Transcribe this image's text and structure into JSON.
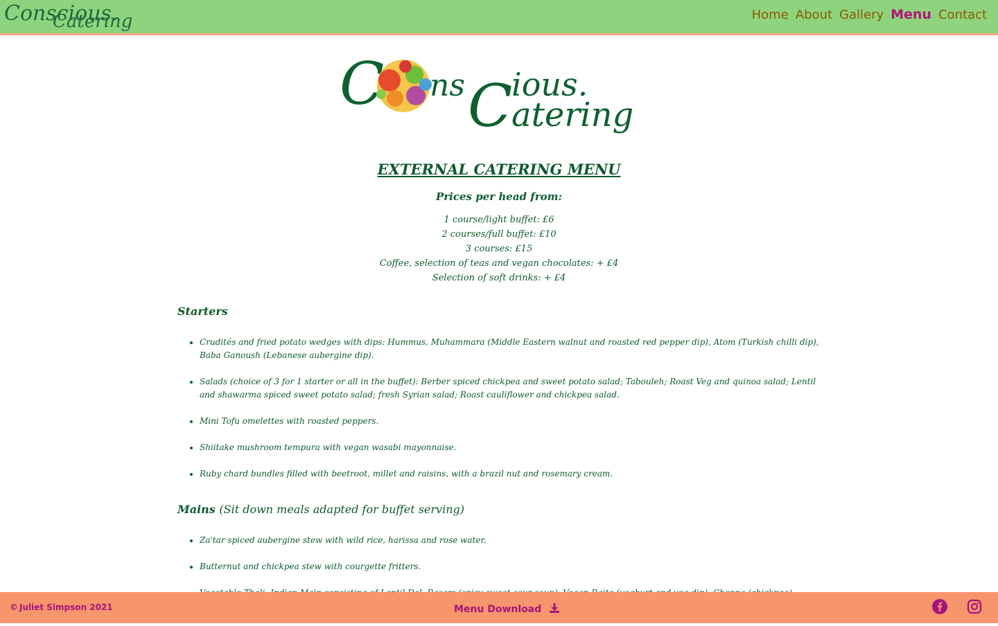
{
  "brand": {
    "logo_text_1": "Conscious.",
    "logo_text_2": "Catering"
  },
  "nav": {
    "items": [
      {
        "label": "Home"
      },
      {
        "label": "About"
      },
      {
        "label": "Gallery"
      },
      {
        "label": "Menu"
      },
      {
        "label": "Contact"
      }
    ],
    "active": "Menu"
  },
  "menu": {
    "title": "EXTERNAL CATERING MENU",
    "prices_heading": "Prices per head from:",
    "prices": [
      "1 course/light buffet: £6",
      "2 courses/full buffet: £10",
      "3 courses: £15",
      "Coffee, selection of teas and vegan chocolates: + £4",
      "Selection of soft drinks: + £4"
    ],
    "starters_heading": "Starters",
    "starters": [
      "Crudités and fried potato wedges with dips: Hummus, Muhammara (Middle Eastern walnut and roasted red pepper dip), Atom (Turkish chilli dip), Baba Ganoush (Lebanese aubergine dip).",
      "Salads (choice of 3 for 1 starter or all in the buffet): Berber spiced chickpea and sweet potato salad; Tabouleh; Roast Veg and quinoa salad; Lentil and shawarma spiced sweet potato salad; fresh Syrian salad; Roast cauliflower and chickpea salad.",
      "Mini Tofu omelettes with roasted peppers.",
      "Shiitake mushroom tempura with vegan wasabi mayonnaise.",
      "Ruby chard bundles filled with beetroot, millet and raisins, with a brazil nut and rosemary cream."
    ],
    "mains_heading": "Mains",
    "mains_sub": "(Sit down meals adapted for buffet serving)",
    "mains": [
      "Za'tar spiced aubergine stew with wild rice, harissa and rose water.",
      "Butternut and chickpea stew with courgette fritters.",
      "Vegetable Thali: Indian Main consisting of Lentil Dal, Rasam (spicy sweet-sour soup), Vegan Raita (yoghurt and veg dip), Channa (chickpea) Masala, Sambar &"
    ]
  },
  "footer": {
    "copyright": "Juliet Simpson 2021",
    "download_label": "Menu Download",
    "social": [
      "facebook-icon",
      "instagram-icon"
    ]
  },
  "colors": {
    "nav_bg": "#8ed47e",
    "footer_bg": "#f7956c",
    "text_green": "#0d5a2e",
    "accent_magenta": "#a3167d",
    "nav_link": "#8a5a00"
  }
}
